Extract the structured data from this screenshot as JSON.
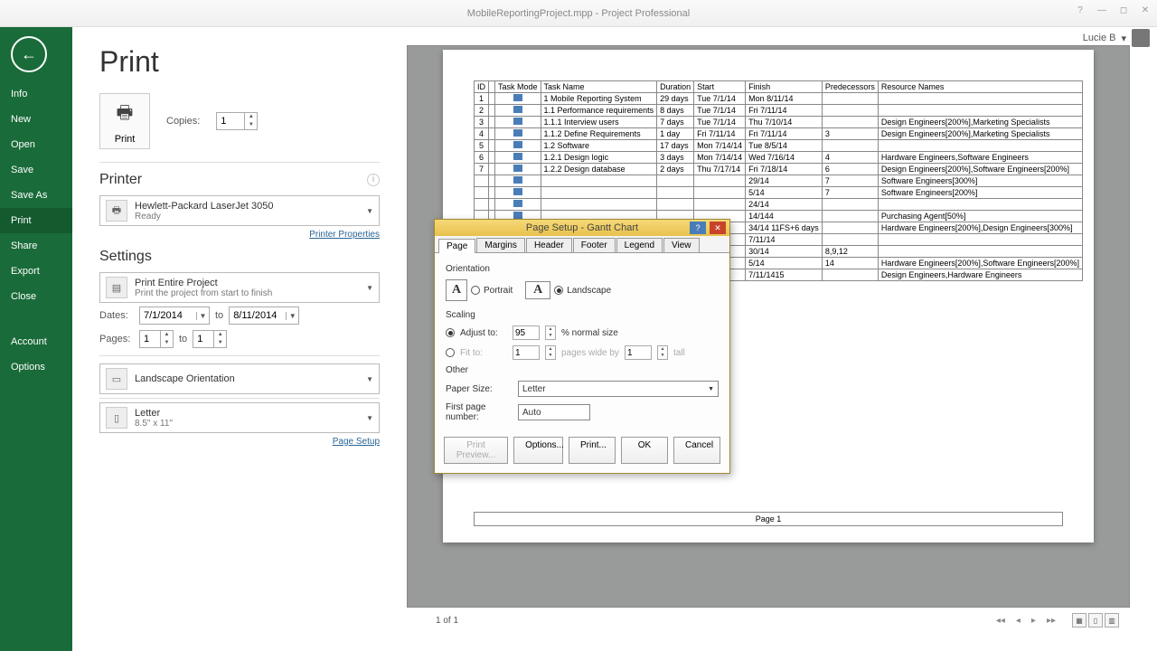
{
  "window": {
    "title": "MobileReportingProject.mpp - Project Professional",
    "user": "Lucie B"
  },
  "sidebar": {
    "items": [
      "Info",
      "New",
      "Open",
      "Save",
      "Save As",
      "Print",
      "Share",
      "Export",
      "Close",
      "Account",
      "Options"
    ],
    "active": "Print"
  },
  "page": {
    "title": "Print",
    "copies_label": "Copies:",
    "copies_value": "1",
    "print_button": "Print"
  },
  "printer": {
    "heading": "Printer",
    "name": "Hewlett-Packard LaserJet 3050",
    "status": "Ready",
    "properties_link": "Printer Properties"
  },
  "settings": {
    "heading": "Settings",
    "scope_title": "Print Entire Project",
    "scope_sub": "Print the project from start to finish",
    "dates_label": "Dates:",
    "date_from": "7/1/2014",
    "date_to": "8/11/2014",
    "to_label": "to",
    "pages_label": "Pages:",
    "page_from": "1",
    "page_to": "1",
    "orientation": "Landscape Orientation",
    "paper_name": "Letter",
    "paper_size": "8.5\" x 11\"",
    "page_setup_link": "Page Setup"
  },
  "preview": {
    "columns": [
      "ID",
      "",
      "Task Mode",
      "Task Name",
      "Duration",
      "Start",
      "Finish",
      "Predecessors",
      "Resource Names"
    ],
    "rows": [
      {
        "id": "1",
        "name": "1 Mobile Reporting System",
        "dur": "29 days",
        "start": "Tue 7/1/14",
        "finish": "Mon 8/11/14",
        "pred": "",
        "res": ""
      },
      {
        "id": "2",
        "name": "   1.1 Performance requirements",
        "dur": "8 days",
        "start": "Tue 7/1/14",
        "finish": "Fri 7/11/14",
        "pred": "",
        "res": ""
      },
      {
        "id": "3",
        "name": "      1.1.1 Interview users",
        "dur": "7 days",
        "start": "Tue 7/1/14",
        "finish": "Thu 7/10/14",
        "pred": "",
        "res": "Design Engineers[200%],Marketing Specialists"
      },
      {
        "id": "4",
        "name": "      1.1.2 Define Requirements",
        "dur": "1 day",
        "start": "Fri 7/11/14",
        "finish": "Fri 7/11/14",
        "pred": "3",
        "res": "Design Engineers[200%],Marketing Specialists"
      },
      {
        "id": "5",
        "name": "   1.2 Software",
        "dur": "17 days",
        "start": "Mon 7/14/14",
        "finish": "Tue 8/5/14",
        "pred": "",
        "res": ""
      },
      {
        "id": "6",
        "name": "      1.2.1 Design logic",
        "dur": "3 days",
        "start": "Mon 7/14/14",
        "finish": "Wed 7/16/14",
        "pred": "4",
        "res": "Hardware Engineers,Software Engineers"
      },
      {
        "id": "7",
        "name": "      1.2.2 Design database",
        "dur": "2 days",
        "start": "Thu 7/17/14",
        "finish": "Fri 7/18/14",
        "pred": "6",
        "res": "Design Engineers[200%],Software Engineers[200%]"
      },
      {
        "id": "",
        "name": "",
        "dur": "",
        "start": "",
        "finish": "29/14",
        "pred": "7",
        "res": "Software Engineers[300%]"
      },
      {
        "id": "",
        "name": "",
        "dur": "",
        "start": "",
        "finish": "5/14",
        "pred": "7",
        "res": "Software Engineers[200%]"
      },
      {
        "id": "",
        "name": "",
        "dur": "",
        "start": "",
        "finish": "24/14",
        "pred": "",
        "res": ""
      },
      {
        "id": "",
        "name": "",
        "dur": "",
        "start": "",
        "finish": "14/144",
        "pred": "",
        "res": "Purchasing Agent[50%]"
      },
      {
        "id": "",
        "name": "",
        "dur": "",
        "start": "",
        "finish": "34/14 11FS+6 days",
        "pred": "",
        "res": "Hardware Engineers[200%],Design Engineers[300%]"
      },
      {
        "id": "",
        "name": "",
        "dur": "",
        "start": "",
        "finish": "7/11/14",
        "pred": "",
        "res": ""
      },
      {
        "id": "",
        "name": "",
        "dur": "",
        "start": "",
        "finish": "30/14",
        "pred": "8,9,12",
        "res": ""
      },
      {
        "id": "",
        "name": "",
        "dur": "",
        "start": "",
        "finish": "5/14",
        "pred": "14",
        "res": "Hardware Engineers[200%],Software Engineers[200%]"
      },
      {
        "id": "",
        "name": "",
        "dur": "",
        "start": "",
        "finish": "7/11/1415",
        "pred": "",
        "res": "Design Engineers,Hardware Engineers"
      }
    ],
    "footer": "Page 1",
    "pager": "1 of 1"
  },
  "dialog": {
    "title": "Page Setup - Gantt Chart",
    "tabs": [
      "Page",
      "Margins",
      "Header",
      "Footer",
      "Legend",
      "View"
    ],
    "active_tab": "Page",
    "orientation_label": "Orientation",
    "portrait": "Portrait",
    "landscape": "Landscape",
    "scaling_label": "Scaling",
    "adjust_label": "Adjust to:",
    "adjust_value": "95",
    "adjust_suffix": "% normal size",
    "fit_label": "Fit to:",
    "fit_wide": "1",
    "fit_wide_label": "pages wide by",
    "fit_tall_value": "1",
    "fit_tall_label": "tall",
    "other_label": "Other",
    "paper_size_label": "Paper Size:",
    "paper_size_value": "Letter",
    "first_page_label": "First page number:",
    "first_page_value": "Auto",
    "buttons": {
      "preview": "Print Preview...",
      "options": "Options...",
      "print": "Print...",
      "ok": "OK",
      "cancel": "Cancel"
    }
  }
}
